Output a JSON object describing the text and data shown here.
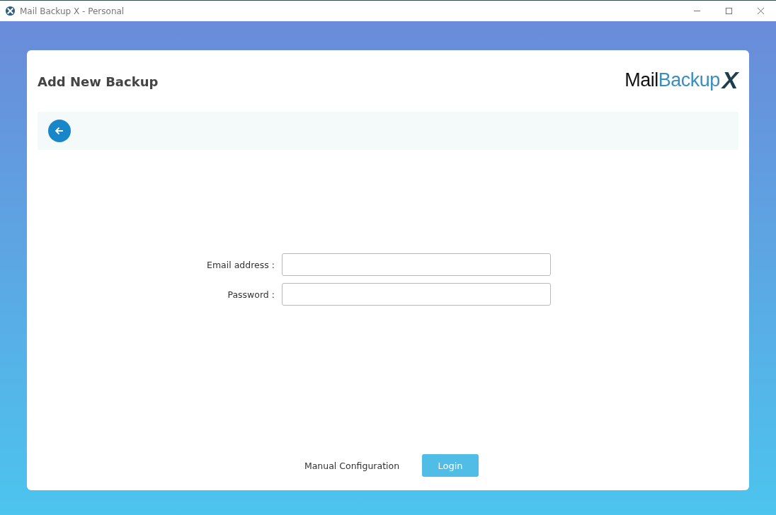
{
  "window": {
    "title": "Mail Backup X - Personal"
  },
  "header": {
    "title": "Add New Backup",
    "logo": [
      {
        "text": "Mail",
        "color": "#111111"
      },
      {
        "text": "Backup",
        "color": "#3a8fc0"
      },
      {
        "text": "X",
        "color": "#1e3d4f"
      }
    ]
  },
  "form": {
    "fields": [
      {
        "label": "Email address :"
      },
      {
        "label": "Password :"
      }
    ]
  },
  "buttons": {
    "manual": "Manual Configuration",
    "login": "Login"
  }
}
